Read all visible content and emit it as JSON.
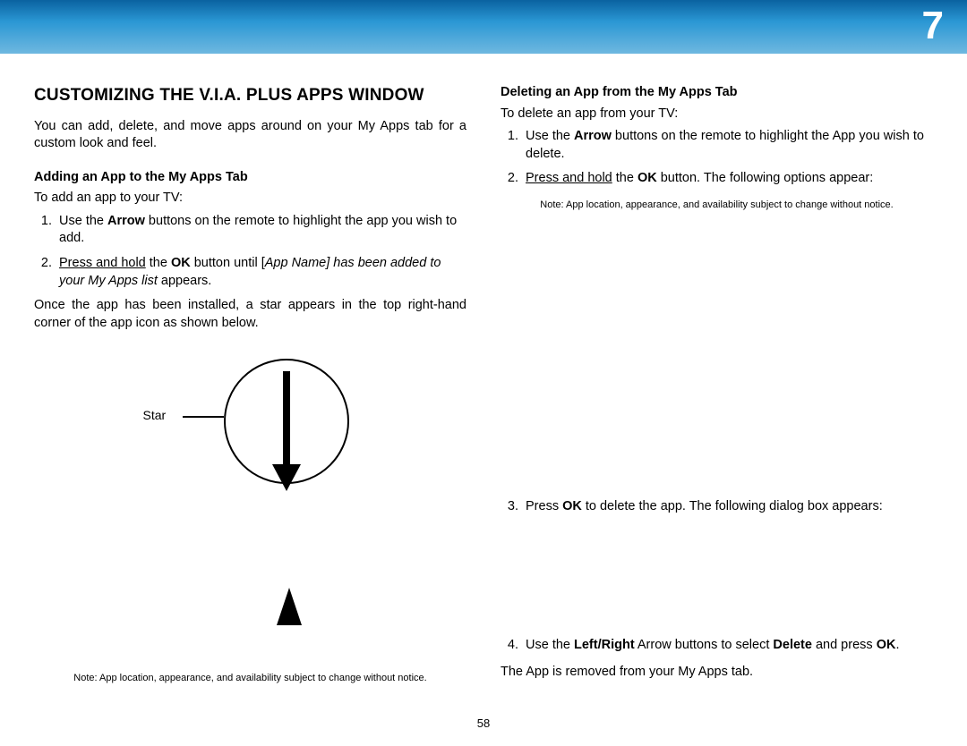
{
  "chapter_number": "7",
  "page_number": "58",
  "left": {
    "heading": "CUSTOMIZING THE V.I.A. PLUS APPS WINDOW",
    "intro": "You can add, delete, and move apps around on your My Apps tab for a custom look and feel.",
    "add_heading": "Adding an App to the My Apps Tab",
    "add_intro": "To add an app to your TV:",
    "add_step1_a": "Use the ",
    "add_step1_arrow": "Arrow",
    "add_step1_b": " buttons on the remote to highlight the app you wish to add.",
    "add_step2_ph": "Press and hold",
    "add_step2_a": " the ",
    "add_step2_ok": "OK",
    "add_step2_b": " button until [",
    "add_step2_it": "App Name] has been added to your My Apps list",
    "add_step2_c": " appears.",
    "installed": "Once the app has been installed, a star appears in the top right-hand corner of the app icon as shown below.",
    "star_label": "Star",
    "note": "Note: App location, appearance, and availability subject to change without notice."
  },
  "right": {
    "del_heading": "Deleting an App from the My Apps Tab",
    "del_intro": "To delete an app from your TV:",
    "del_step1_a": "Use the ",
    "del_step1_arrow": "Arrow",
    "del_step1_b": " buttons on the remote to highlight the App you wish to delete.",
    "del_step2_ph": "Press and hold",
    "del_step2_a": " the ",
    "del_step2_ok": "OK",
    "del_step2_b": " button. The following options appear:",
    "note": "Note: App location, appearance, and availability subject to change without notice.",
    "del_step3_a": "Press ",
    "del_step3_ok": "OK",
    "del_step3_b": " to delete the app. The following dialog box appears:",
    "del_step4_a": "Use the ",
    "del_step4_lr": "Left/Right",
    "del_step4_b": " Arrow buttons to select ",
    "del_step4_del": "Delete",
    "del_step4_c": " and press ",
    "del_step4_ok": "OK",
    "del_step4_d": ".",
    "removed": "The App is removed from your My Apps tab."
  }
}
